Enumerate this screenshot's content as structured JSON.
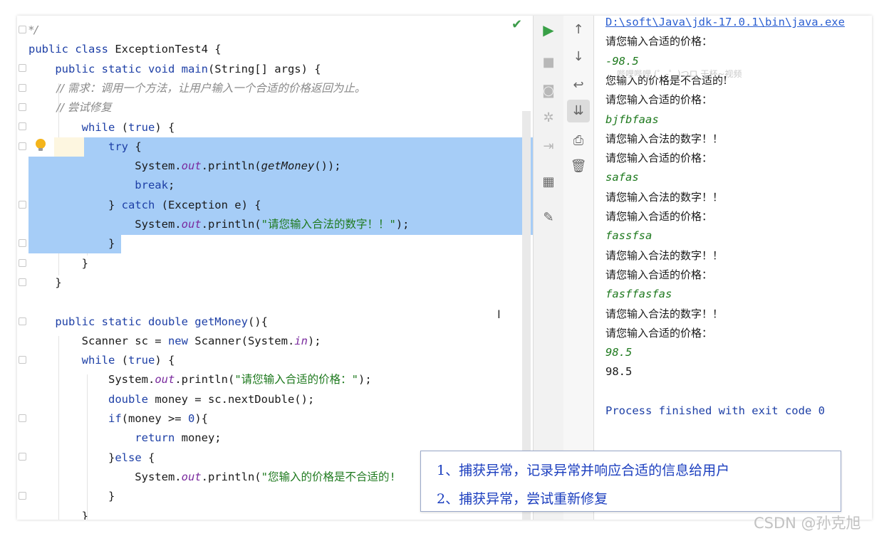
{
  "editor": {
    "lines": [
      {
        "id": "l0",
        "tokens": [
          {
            "t": "*/",
            "c": "cm"
          }
        ]
      },
      {
        "id": "l1",
        "tokens": [
          {
            "t": "public class ",
            "c": "kw"
          },
          {
            "t": "ExceptionTest4 {",
            "c": ""
          }
        ]
      },
      {
        "id": "l2",
        "tokens": [
          {
            "t": "    public static void ",
            "c": "kw"
          },
          {
            "t": "main",
            "c": "kw"
          },
          {
            "t": "(String[] args) {",
            "c": ""
          }
        ]
      },
      {
        "id": "l3",
        "tokens": [
          {
            "t": "        // 需求：调用一个方法，让用户输入一个合适的价格返回为止。",
            "c": "cm"
          }
        ]
      },
      {
        "id": "l4",
        "tokens": [
          {
            "t": "        // 尝试修复",
            "c": "cm"
          }
        ]
      },
      {
        "id": "l5",
        "tokens": [
          {
            "t": "        while ",
            "c": "kw"
          },
          {
            "t": "(",
            "c": ""
          },
          {
            "t": "true",
            "c": "kw"
          },
          {
            "t": ") {",
            "c": ""
          }
        ]
      },
      {
        "id": "l6",
        "tokens": [
          {
            "t": "            try ",
            "c": "kw"
          },
          {
            "t": "{",
            "c": ""
          }
        ]
      },
      {
        "id": "l7",
        "tokens": [
          {
            "t": "                System.",
            "c": ""
          },
          {
            "t": "out",
            "c": "it"
          },
          {
            "t": ".println(",
            "c": ""
          },
          {
            "t": "getMoney",
            "c": "fn"
          },
          {
            "t": "());",
            "c": ""
          }
        ]
      },
      {
        "id": "l8",
        "tokens": [
          {
            "t": "                break",
            "c": "kw"
          },
          {
            "t": ";",
            "c": ""
          }
        ]
      },
      {
        "id": "l9",
        "tokens": [
          {
            "t": "            } ",
            "c": ""
          },
          {
            "t": "catch ",
            "c": "kw"
          },
          {
            "t": "(Exception e) {",
            "c": ""
          }
        ]
      },
      {
        "id": "l10",
        "tokens": [
          {
            "t": "                System.",
            "c": ""
          },
          {
            "t": "out",
            "c": "it"
          },
          {
            "t": ".println(",
            "c": ""
          },
          {
            "t": "\"请您输入合法的数字！！\"",
            "c": "st"
          },
          {
            "t": ");",
            "c": ""
          }
        ]
      },
      {
        "id": "l11",
        "tokens": [
          {
            "t": "            }",
            "c": ""
          }
        ]
      },
      {
        "id": "l12",
        "tokens": [
          {
            "t": "        }",
            "c": ""
          }
        ]
      },
      {
        "id": "l13",
        "tokens": [
          {
            "t": "    }",
            "c": ""
          }
        ]
      },
      {
        "id": "l14",
        "tokens": [
          {
            "t": "",
            "c": ""
          }
        ]
      },
      {
        "id": "l15",
        "tokens": [
          {
            "t": "    public static double ",
            "c": "kw"
          },
          {
            "t": "getMoney",
            "c": "kw"
          },
          {
            "t": "(){",
            "c": ""
          }
        ]
      },
      {
        "id": "l16",
        "tokens": [
          {
            "t": "        Scanner sc = ",
            "c": ""
          },
          {
            "t": "new ",
            "c": "kw"
          },
          {
            "t": "Scanner(System.",
            "c": ""
          },
          {
            "t": "in",
            "c": "it"
          },
          {
            "t": ");",
            "c": ""
          }
        ]
      },
      {
        "id": "l17",
        "tokens": [
          {
            "t": "        while ",
            "c": "kw"
          },
          {
            "t": "(",
            "c": ""
          },
          {
            "t": "true",
            "c": "kw"
          },
          {
            "t": ") {",
            "c": ""
          }
        ]
      },
      {
        "id": "l18",
        "tokens": [
          {
            "t": "            System.",
            "c": ""
          },
          {
            "t": "out",
            "c": "it"
          },
          {
            "t": ".println(",
            "c": ""
          },
          {
            "t": "\"请您输入合适的价格：\"",
            "c": "st"
          },
          {
            "t": ");",
            "c": ""
          }
        ]
      },
      {
        "id": "l19",
        "tokens": [
          {
            "t": "            double ",
            "c": "kw"
          },
          {
            "t": "money = sc.nextDouble();",
            "c": ""
          }
        ]
      },
      {
        "id": "l20",
        "tokens": [
          {
            "t": "            if",
            "c": "kw"
          },
          {
            "t": "(money >= ",
            "c": ""
          },
          {
            "t": "0",
            "c": "num"
          },
          {
            "t": "){",
            "c": ""
          }
        ]
      },
      {
        "id": "l21",
        "tokens": [
          {
            "t": "                return ",
            "c": "kw"
          },
          {
            "t": "money;",
            "c": ""
          }
        ]
      },
      {
        "id": "l22",
        "tokens": [
          {
            "t": "            }",
            "c": ""
          },
          {
            "t": "else ",
            "c": "kw"
          },
          {
            "t": "{",
            "c": ""
          }
        ]
      },
      {
        "id": "l23",
        "tokens": [
          {
            "t": "                System.",
            "c": ""
          },
          {
            "t": "out",
            "c": "it"
          },
          {
            "t": ".println(",
            "c": ""
          },
          {
            "t": "\"您输入的价格是不合适的!",
            "c": "st"
          }
        ]
      },
      {
        "id": "l24",
        "tokens": [
          {
            "t": "            }",
            "c": ""
          }
        ]
      },
      {
        "id": "l25",
        "tokens": [
          {
            "t": "        }",
            "c": ""
          }
        ]
      }
    ]
  },
  "toolbar_left": {
    "icons": [
      "run-icon",
      "stop-icon",
      "camera-icon",
      "debug-icon",
      "exit-icon",
      "layout-icon",
      "pin-icon"
    ]
  },
  "toolbar_right": {
    "icons": [
      "up-arrow-icon",
      "down-arrow-icon",
      "soft-wrap-icon",
      "scroll-to-end-icon",
      "print-icon",
      "trash-icon"
    ]
  },
  "console": {
    "lines": [
      {
        "t": "D:\\soft\\Java\\jdk-17.0.1\\bin\\java.exe",
        "c": "c-path"
      },
      {
        "t": "请您输入合适的价格：",
        "c": "c-prompt"
      },
      {
        "t": "-98.5",
        "c": "c-input"
      },
      {
        "t": "您输入的价格是不合适的!",
        "c": "c-prompt"
      },
      {
        "t": "请您输入合适的价格：",
        "c": "c-prompt"
      },
      {
        "t": "bjfbfaas",
        "c": "c-input"
      },
      {
        "t": "请您输入合法的数字！！",
        "c": "c-prompt"
      },
      {
        "t": "请您输入合适的价格：",
        "c": "c-prompt"
      },
      {
        "t": "safas",
        "c": "c-input"
      },
      {
        "t": "请您输入合法的数字！！",
        "c": "c-prompt"
      },
      {
        "t": "请您输入合适的价格：",
        "c": "c-prompt"
      },
      {
        "t": "fassfsa",
        "c": "c-input"
      },
      {
        "t": "请您输入合法的数字！！",
        "c": "c-prompt"
      },
      {
        "t": "请您输入合适的价格：",
        "c": "c-prompt"
      },
      {
        "t": "fasffasfas",
        "c": "c-input"
      },
      {
        "t": "请您输入合法的数字！！",
        "c": "c-prompt"
      },
      {
        "t": "请您输入合适的价格：",
        "c": "c-prompt"
      },
      {
        "t": "98.5",
        "c": "c-input"
      },
      {
        "t": "98.5",
        "c": "c-out"
      },
      {
        "t": "",
        "c": "c-out"
      },
      {
        "t": "Process finished with exit code 0",
        "c": "c-exit"
      }
    ],
    "faint_overlay": "哔哩哔哩 (゜-゜)つロ 干杯~视频"
  },
  "note": {
    "line1": "1、捕获异常，记录异常并响应合适的信息给用户",
    "line2": "2、捕获异常，尝试重新修复"
  },
  "watermark": "CSDN @孙克旭"
}
